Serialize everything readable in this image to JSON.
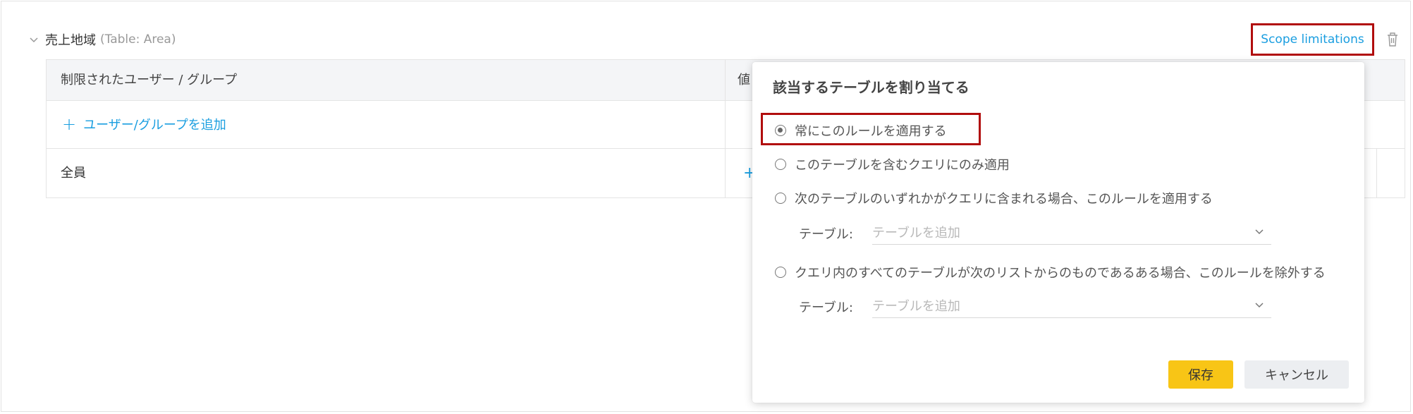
{
  "section": {
    "title": "売上地域",
    "subtitle": "(Table: Area)",
    "scope_link": "Scope limitations"
  },
  "table": {
    "headers": [
      "制限されたユーザー / グループ",
      "値"
    ],
    "add_label": "ユーザー/グループを追加",
    "rows": [
      {
        "name": "全員"
      }
    ]
  },
  "popover": {
    "title": "該当するテーブルを割り当てる",
    "options": [
      {
        "label": "常にこのルールを適用する",
        "checked": true
      },
      {
        "label": "このテーブルを含むクエリにのみ適用",
        "checked": false
      },
      {
        "label": "次のテーブルのいずれかがクエリに含まれる場合、このルールを適用する",
        "checked": false
      },
      {
        "label": "クエリ内のすべてのテーブルが次のリストからのものであるある場合、このルールを除外する",
        "checked": false
      }
    ],
    "table_label": "テーブル:",
    "table_placeholder": "テーブルを追加",
    "save": "保存",
    "cancel": "キャンセル"
  },
  "colors": {
    "accent": "#1a9ee0",
    "primary_button": "#f8c516",
    "highlight": "#b10d0d"
  },
  "icons": [
    "chevron-down-icon",
    "trash-icon",
    "plus-icon",
    "radio-icon"
  ]
}
